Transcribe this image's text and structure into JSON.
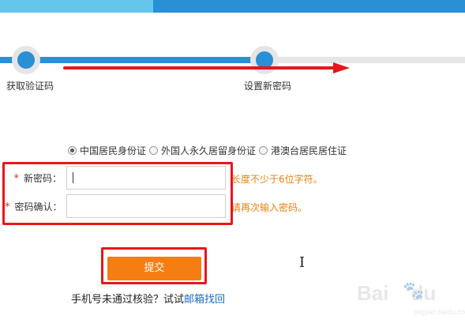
{
  "steps": [
    {
      "label": "获取验证码",
      "state": "done"
    },
    {
      "label": "设置新密码",
      "state": "current"
    }
  ],
  "id_types": {
    "options": [
      "中国居民身份证",
      "外国人永久居留身份证",
      "港澳台居民居住证"
    ],
    "selected": "中国居民身份证"
  },
  "form": {
    "new_password": {
      "required_mark": "*",
      "label": "新密码：",
      "value": "",
      "hint": "长度不少于6位字符。"
    },
    "confirm_password": {
      "required_mark": "*",
      "label": "密码确认：",
      "value": "",
      "hint": "请再次输入密码。"
    },
    "submit_label": "提交"
  },
  "footer": {
    "text": "手机号未通过核验？试试",
    "link_text": "邮箱找回"
  },
  "watermark": {
    "brand": "Bai",
    "brand_suffix": "du",
    "sub": "jingyan.baidu.com"
  },
  "colors": {
    "accent_blue": "#2a8fd4",
    "light_blue": "#63c6ea",
    "annotation_red": "#e8161b",
    "required_red": "#e0301e",
    "hint_orange": "#e8820c",
    "button_orange": "#f57e12",
    "link_blue": "#1a6cc7"
  }
}
